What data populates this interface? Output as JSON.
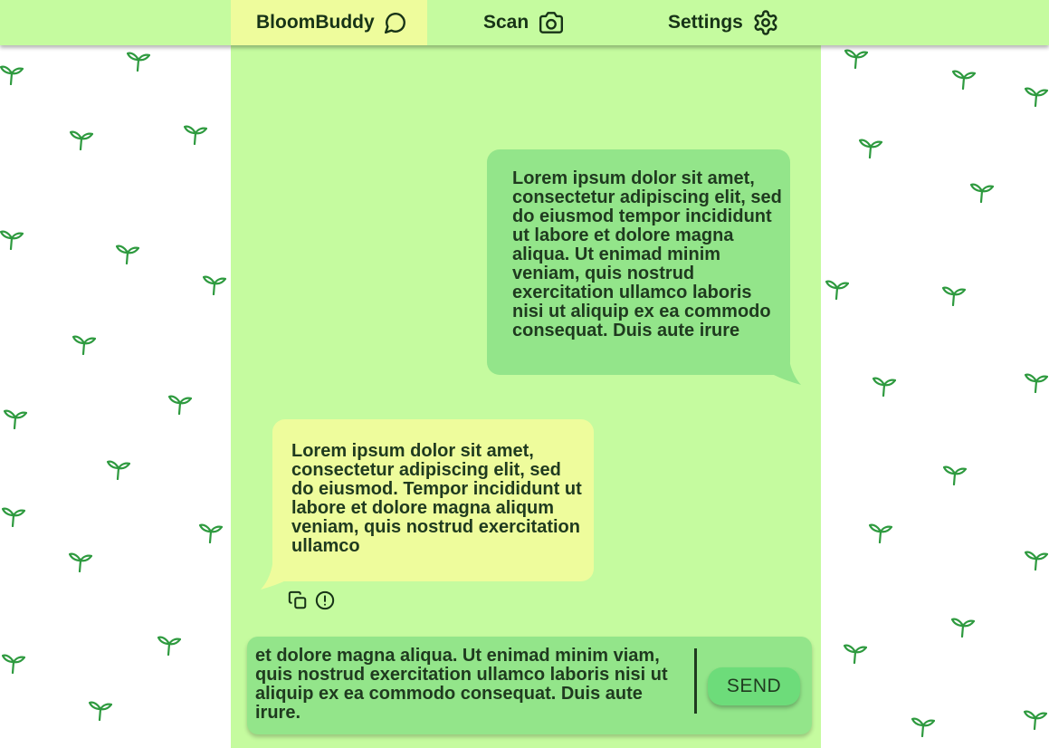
{
  "nav": {
    "items": [
      {
        "label": "BloomBuddy",
        "icon": "chat-bubble-icon",
        "active": true
      },
      {
        "label": "Scan",
        "icon": "camera-icon",
        "active": false
      },
      {
        "label": "Settings",
        "icon": "gear-icon",
        "active": false
      }
    ]
  },
  "chat": {
    "messages": [
      {
        "sender": "user",
        "text": "Lorem ipsum dolor sit amet, consectetur adipiscing elit, sed do eiusmod tempor incididunt ut labore et dolore magna aliqua. Ut enimad minim veniam, quis nostrud exercitation ullamco laboris nisi ut aliquip ex ea commodo consequat. Duis aute irure"
      },
      {
        "sender": "bot",
        "text": "Lorem ipsum dolor sit amet, consectetur adipiscing elit, sed do eiusmod. Tempor incididunt ut labore et dolore magna aliqum veniam, quis nostrud exercitation ullamco"
      }
    ],
    "message_actions": [
      "copy-icon",
      "report-icon"
    ]
  },
  "composer": {
    "value": "et dolore magna aliqua. Ut enimad minim viam, quis nostrud exercitation ullamco laboris nisi ut aliquip ex ea commodo consequat. Duis aute irure.",
    "send_label": "SEND"
  },
  "background": {
    "pattern_icon": "sprout-icon"
  },
  "colors": {
    "nav_bg": "#c5fb9f",
    "nav_active": "#eefc9c",
    "chat_bg": "#c5fb9f",
    "user_bubble": "#93e58a",
    "bot_bubble": "#eefc9c",
    "send_button": "#6ddc7a",
    "sprout": "#2e9a3f"
  }
}
